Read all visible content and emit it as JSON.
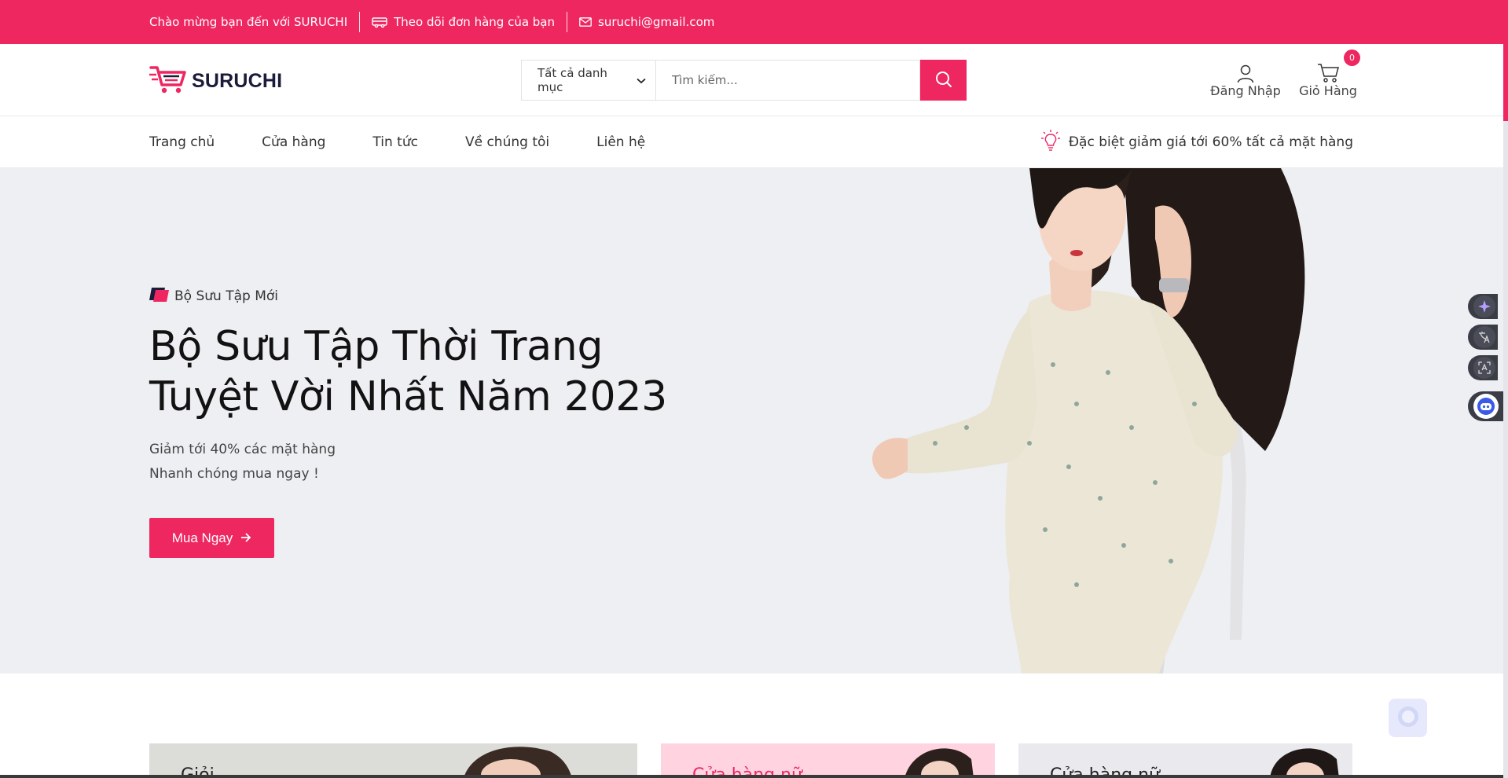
{
  "topbar": {
    "welcome": "Chào mừng bạn đến với SURUCHI",
    "track_order": "Theo dõi đơn hàng của bạn",
    "email": "suruchi@gmail.com"
  },
  "header": {
    "logo_text": "SURUCHI",
    "category_select": "Tất cả danh mục",
    "search_placeholder": "Tìm kiếm...",
    "login_label": "Đăng Nhập",
    "cart_label": "Giỏ Hàng",
    "cart_count": "0"
  },
  "nav": {
    "items": [
      {
        "label": "Trang chủ"
      },
      {
        "label": "Cửa hàng"
      },
      {
        "label": "Tin tức"
      },
      {
        "label": "Về chúng tôi"
      },
      {
        "label": "Liên hệ"
      }
    ],
    "promo": "Đặc biệt giảm giá tới 60% tất cả mặt hàng"
  },
  "hero": {
    "tag": "Bộ Sưu Tập Mới",
    "title_line1": "Bộ Sưu Tập Thời Trang",
    "title_line2": "Tuyệt Vời Nhất Năm 2023",
    "sub_line1": "Giảm tới 40% các mặt hàng",
    "sub_line2": "Nhanh chóng mua ngay !",
    "cta": "Mua Ngay"
  },
  "cards": [
    {
      "title": "Giỏi..."
    },
    {
      "title": "Cửa hàng nữ"
    },
    {
      "title": "Cửa hàng nữ"
    }
  ],
  "colors": {
    "accent": "#ee2761",
    "hero_bg": "#eeeff3",
    "dark": "#1b1b3a"
  },
  "icons": {
    "track": "truck-icon",
    "email": "mail-icon",
    "search": "search-icon",
    "user": "user-icon",
    "cart": "cart-icon",
    "promo": "lightbulb-icon",
    "cta": "arrow-right-icon"
  }
}
